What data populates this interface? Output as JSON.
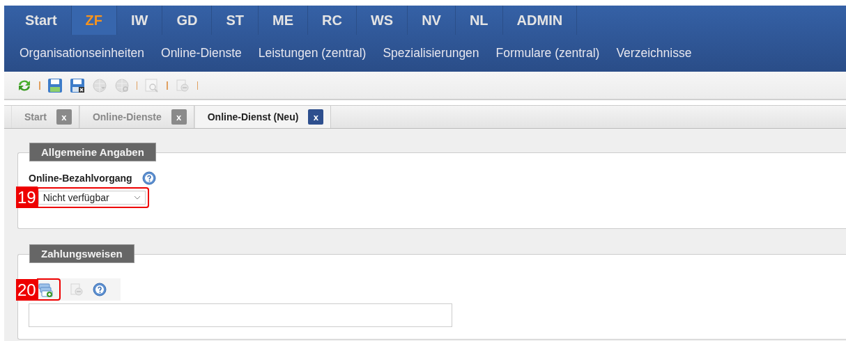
{
  "main_menu": [
    {
      "label": "Start",
      "selected": false
    },
    {
      "label": "ZF",
      "selected": true
    },
    {
      "label": "IW",
      "selected": false
    },
    {
      "label": "GD",
      "selected": false
    },
    {
      "label": "ST",
      "selected": false
    },
    {
      "label": "ME",
      "selected": false
    },
    {
      "label": "RC",
      "selected": false
    },
    {
      "label": "WS",
      "selected": false
    },
    {
      "label": "NV",
      "selected": false
    },
    {
      "label": "NL",
      "selected": false
    },
    {
      "label": "ADMIN",
      "selected": false
    }
  ],
  "sub_menu": [
    "Organisationseinheiten",
    "Online-Dienste",
    "Leistungen (zentral)",
    "Spezialisierungen",
    "Formulare (zentral)",
    "Verzeichnisse"
  ],
  "toolbar": [
    {
      "kind": "refresh",
      "disabled": false
    },
    {
      "kind": "separator"
    },
    {
      "kind": "save",
      "disabled": false
    },
    {
      "kind": "save-close",
      "disabled": false
    },
    {
      "kind": "globe",
      "disabled": true
    },
    {
      "kind": "globe-search",
      "disabled": true
    },
    {
      "kind": "separator"
    },
    {
      "kind": "preview",
      "disabled": true
    },
    {
      "kind": "separator"
    },
    {
      "kind": "delete",
      "disabled": true
    },
    {
      "kind": "separator"
    }
  ],
  "tabs": [
    {
      "label": "Start",
      "selected": false,
      "close": "x"
    },
    {
      "label": "Online-Dienste",
      "selected": false,
      "close": "x"
    },
    {
      "label": "Online-Dienst (Neu)",
      "selected": true,
      "close": "x"
    }
  ],
  "sections": [
    {
      "kind": "fields",
      "legend": "Allgemeine Angaben",
      "field_label": "Online-Bezahlvorgang",
      "select_value": "Nicht verfügbar",
      "callout": "19"
    },
    {
      "kind": "list",
      "legend": "Zahlungsweisen",
      "callout": "20",
      "tools": [
        {
          "kind": "add",
          "disabled": false
        },
        {
          "kind": "delete",
          "disabled": true
        },
        {
          "kind": "help",
          "disabled": false
        }
      ]
    }
  ]
}
